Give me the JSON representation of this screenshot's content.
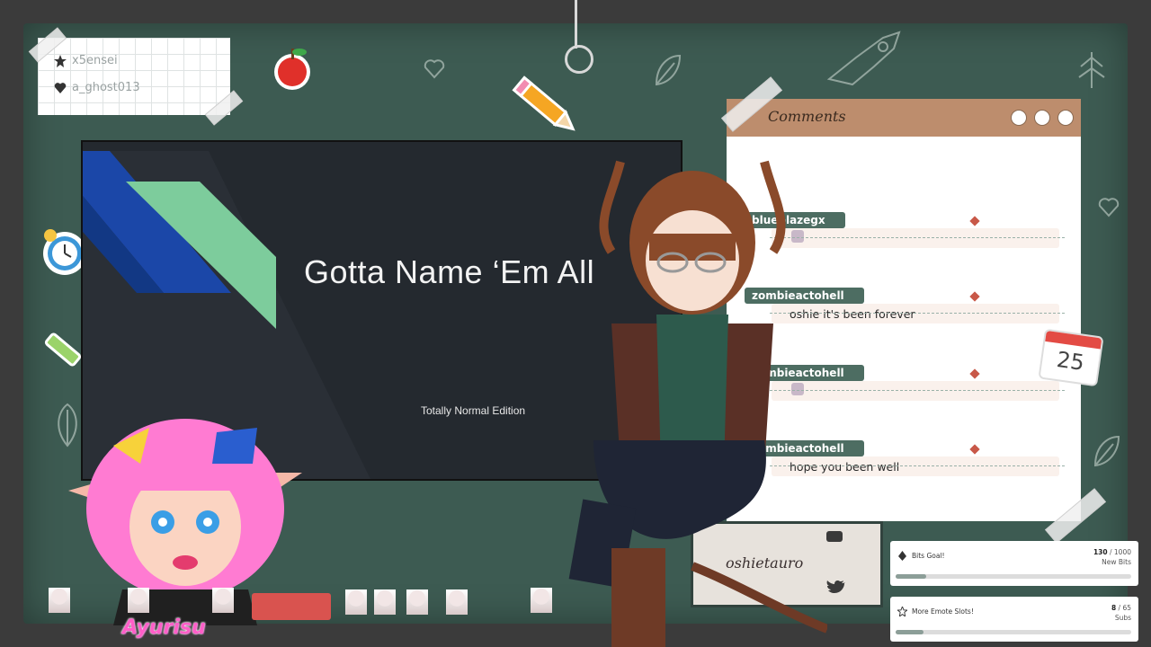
{
  "note": {
    "row1": "x5ensei",
    "row2": "a_ghost013"
  },
  "slide": {
    "title": "Gotta Name ‘Em All",
    "subtitle": "Totally Normal Edition"
  },
  "comments": {
    "title": "Comments",
    "messages": [
      {
        "user": "blueblazegx",
        "text": "",
        "emote": true
      },
      {
        "user": "zombieactohell",
        "text": "oshie it's been forever",
        "emote": false
      },
      {
        "user": "zombieactohell",
        "text": "",
        "emote": true
      },
      {
        "user": "zombieactohell",
        "text": "hope you been well",
        "emote": false
      }
    ]
  },
  "calendar": {
    "day": "25"
  },
  "goals": [
    {
      "label": "Bits Goal!",
      "current": "130",
      "target": "1000",
      "unit": "New Bits",
      "progress": 0.13
    },
    {
      "label": "More Emote Slots!",
      "current": "8",
      "target": "65",
      "unit": "Subs",
      "progress": 0.12
    }
  ],
  "social": {
    "handle": "oshietauro"
  },
  "avatar_name": "Ayurisu",
  "colors": {
    "board": "#3d5b52",
    "slide_bg": "#24292f",
    "slide_blue": "#1b47a8",
    "slide_green": "#7dcc9c",
    "comments_header": "#bd8d6d",
    "name_tag": "#4d6d62",
    "pink_accent": "#ff5ec8"
  },
  "icons": [
    "star-icon",
    "heart-icon",
    "apple-icon",
    "pencil-icon",
    "rocket-icon",
    "leaf-icon",
    "alarm-clock-icon",
    "calendar-icon",
    "youtube-icon",
    "twitter-icon",
    "bits-icon",
    "star-outline-icon"
  ]
}
